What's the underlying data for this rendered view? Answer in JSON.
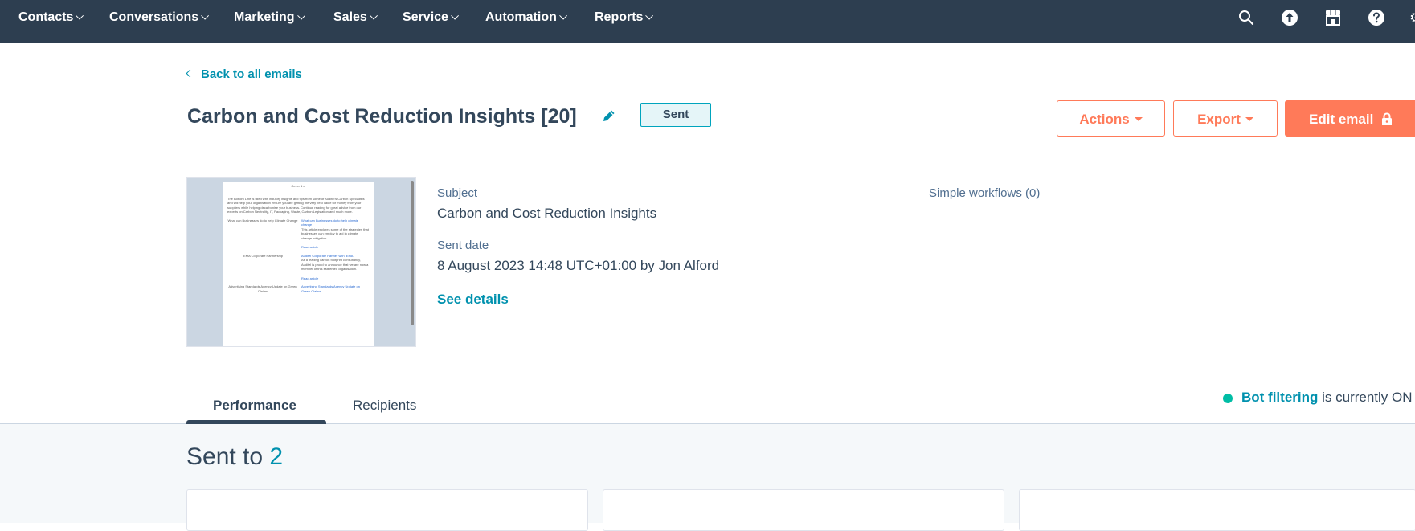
{
  "nav": {
    "items": [
      {
        "label": "Contacts"
      },
      {
        "label": "Conversations"
      },
      {
        "label": "Marketing"
      },
      {
        "label": "Sales"
      },
      {
        "label": "Service"
      },
      {
        "label": "Automation"
      },
      {
        "label": "Reports"
      }
    ],
    "icons": [
      "search-icon",
      "upgrade-arrow-icon",
      "marketplace-icon",
      "help-icon"
    ]
  },
  "header": {
    "back_label": "Back to all emails",
    "title": "Carbon and Cost Reduction Insights [20]",
    "status": "Sent",
    "actions_label": "Actions",
    "export_label": "Export",
    "edit_label": "Edit email"
  },
  "preview": {
    "cover_alt": "Cover 1 a",
    "intro": "The Bottom Line is filled with industry insights and tips from some of Auditel's Carbon Specialists and will help your organisation ensure you are getting the very best value for money from your suppliers while helping decarbonise your business. Continue reading for great advice from our experts on Carbon Neutrality, IT, Packaging, Waste, Carbon Legislation and much more.",
    "articles": [
      {
        "image_alt": "What can Businesses do to help Climate Change",
        "headline": "What can Businesses do to help climate change",
        "body": "This article explores some of the strategies that businesses can employ to aid in climate change mitigation.",
        "link": "Read article"
      },
      {
        "image_alt": "IEMA Corporate Partnership",
        "headline": "Auditel Corporate Partner with IEMA",
        "body": "As a leading carbon footprint consultancy, Auditel is proud to announce that we are now a member of this esteemed organisation.",
        "link": "Read article"
      },
      {
        "image_alt": "Advertising Standards Agency Update on Green Claims",
        "headline": "Advertising Standards Agency Update on Green Claims",
        "body": "",
        "link": ""
      }
    ]
  },
  "details": {
    "subject_label": "Subject",
    "subject_value": "Carbon and Cost Reduction Insights",
    "sent_date_label": "Sent date",
    "sent_date_value": "8 August 2023 14:48 UTC+01:00 by Jon Alford",
    "see_details_label": "See details",
    "workflows_label": "Simple workflows (0)"
  },
  "tabs": [
    {
      "label": "Performance",
      "active": true
    },
    {
      "label": "Recipients",
      "active": false
    }
  ],
  "bot_filter": {
    "link_label": "Bot filtering",
    "status_text": " is currently ON"
  },
  "summary": {
    "sent_to_label": "Sent to ",
    "sent_to_count": "2"
  },
  "colors": {
    "nav_bg": "#2d3e50",
    "accent_orange": "#ff7a59",
    "link_teal": "#0091ae",
    "bot_green": "#00bda5"
  }
}
